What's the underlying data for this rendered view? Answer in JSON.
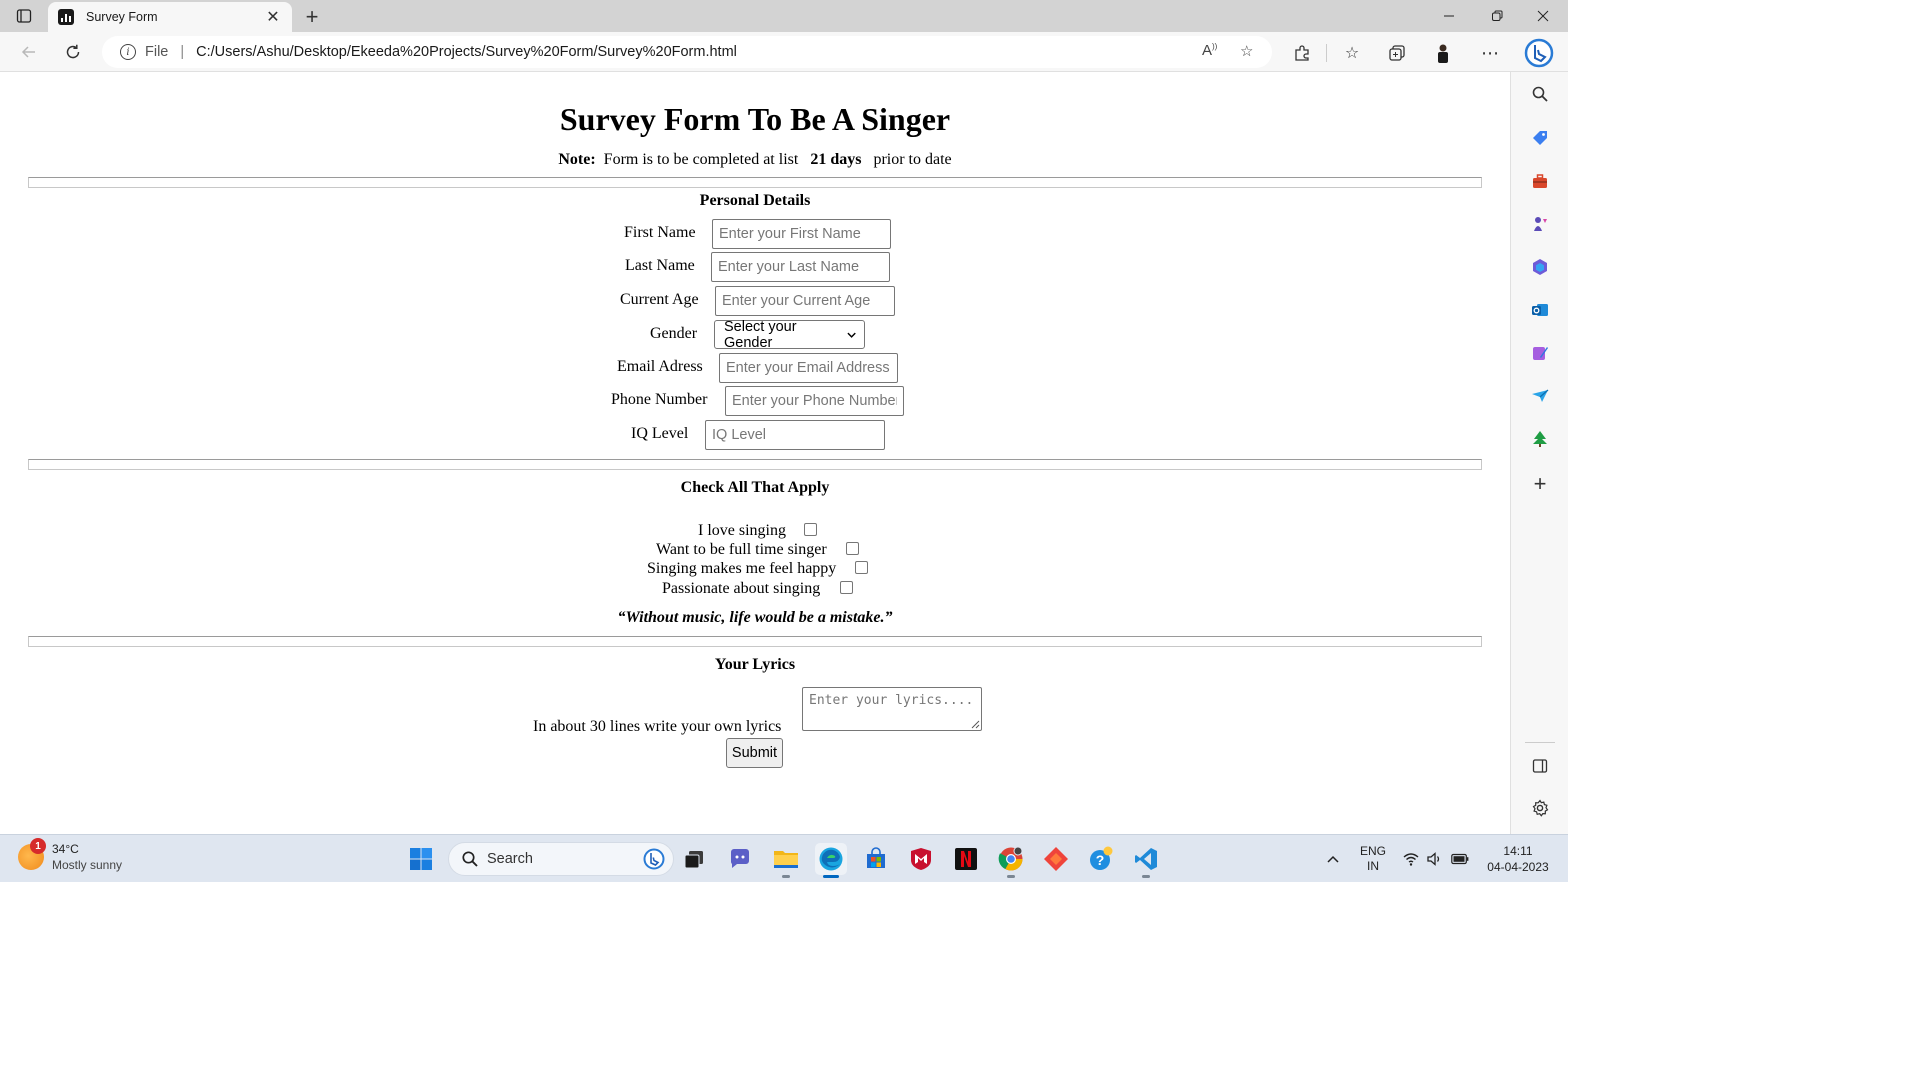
{
  "browser": {
    "tab_title": "Survey Form",
    "new_tab": "+",
    "address_scheme": "File",
    "address_url": "C:/Users/Ashu/Desktop/Ekeeda%20Projects/Survey%20Form/Survey%20Form.html"
  },
  "page": {
    "title": "Survey Form To Be A Singer",
    "note": {
      "label": "Note:",
      "text_before": "Form is to be completed at list",
      "days": "21 days",
      "text_after": "prior to date"
    },
    "personal_details": {
      "title": "Personal Details",
      "first_name": {
        "label": "First Name",
        "placeholder": "Enter your First Name"
      },
      "last_name": {
        "label": "Last Name",
        "placeholder": "Enter your Last Name"
      },
      "age": {
        "label": "Current Age",
        "placeholder": "Enter your Current Age"
      },
      "gender": {
        "label": "Gender",
        "selected": "Select your Gender"
      },
      "email": {
        "label": "Email Adress",
        "placeholder": "Enter your Email Address"
      },
      "phone": {
        "label": "Phone Number",
        "placeholder": "Enter your Phone Number"
      },
      "iq": {
        "label": "IQ Level",
        "placeholder": "IQ Level"
      }
    },
    "checks": {
      "title": "Check All That Apply",
      "items": [
        {
          "label": "I love singing",
          "checked": false
        },
        {
          "label": "Want to be full time singer",
          "checked": false
        },
        {
          "label": "Singing makes me feel happy",
          "checked": false
        },
        {
          "label": "Passionate about singing",
          "checked": false
        }
      ]
    },
    "quote": "“Without music, life would be a mistake.”",
    "lyrics": {
      "title": "Your Lyrics",
      "label": "In about 30 lines write your own lyrics",
      "placeholder": "Enter your lyrics....",
      "submit": "Submit"
    }
  },
  "taskbar": {
    "weather": {
      "badge": "1",
      "temp": "34°C",
      "condition": "Mostly sunny"
    },
    "search": "Search",
    "language": {
      "lang": "ENG",
      "region": "IN"
    },
    "clock": {
      "time": "14:11",
      "date": "04-04-2023"
    }
  },
  "colors": {
    "accent": "#0067c0",
    "tabstrip": "#d3d3d3",
    "toolbar": "#f7f7f7",
    "taskbar": "#dfe6f0"
  }
}
